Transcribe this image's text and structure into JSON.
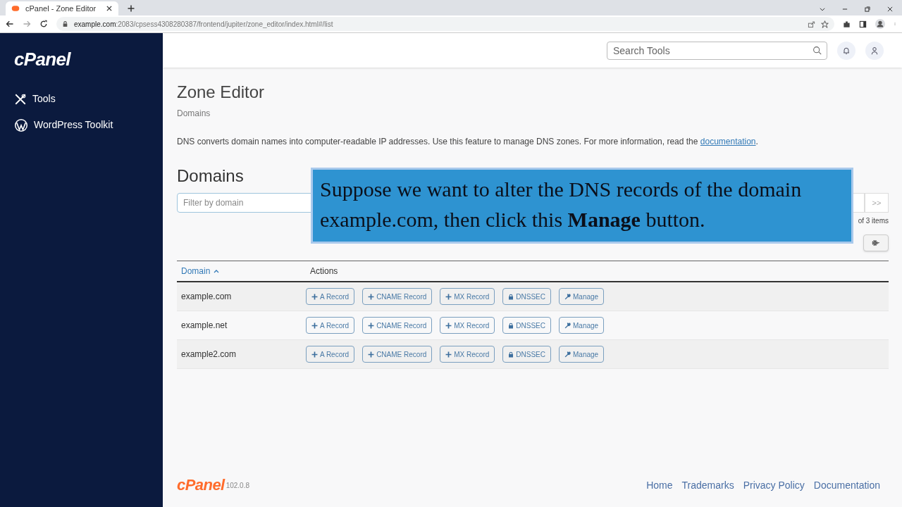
{
  "browser": {
    "tab_title": "cPanel - Zone Editor",
    "url_host": "example.com",
    "url_path": ":2083/cpsess4308280387/frontend/jupiter/zone_editor/index.html#/list"
  },
  "sidebar": {
    "logo": "cPanel",
    "items": [
      {
        "label": "Tools"
      },
      {
        "label": "WordPress Toolkit"
      }
    ]
  },
  "header": {
    "search": {
      "placeholder": "Search Tools"
    }
  },
  "page": {
    "title": "Zone Editor",
    "breadcrumb": "Domains",
    "intro": "DNS converts domain names into computer-readable IP addresses. Use this feature to manage DNS zones. For more information, read the ",
    "intro_link": "documentation",
    "intro_end": "."
  },
  "domains": {
    "heading": "Domains",
    "filter": {
      "placeholder": "Filter by domain"
    },
    "pagination": [
      ">>"
    ],
    "count": "of 3 items",
    "columns": [
      "Domain",
      "Actions"
    ],
    "rows": [
      {
        "domain": "example.com",
        "actions": [
          "A Record",
          "CNAME Record",
          "MX Record",
          "DNSSEC",
          "Manage"
        ]
      },
      {
        "domain": "example.net",
        "actions": [
          "A Record",
          "CNAME Record",
          "MX Record",
          "DNSSEC",
          "Manage"
        ]
      },
      {
        "domain": "example2.com",
        "actions": [
          "A Record",
          "CNAME Record",
          "MX Record",
          "DNSSEC",
          "Manage"
        ]
      }
    ]
  },
  "caption": "Suppose we want to alter the DNS records of the domain example.com, then click this **Manage** button.",
  "footer": {
    "logo": "cPanel",
    "version": "102.0.8",
    "links": [
      "Home",
      "Trademarks",
      "Privacy Policy",
      "Documentation"
    ]
  }
}
